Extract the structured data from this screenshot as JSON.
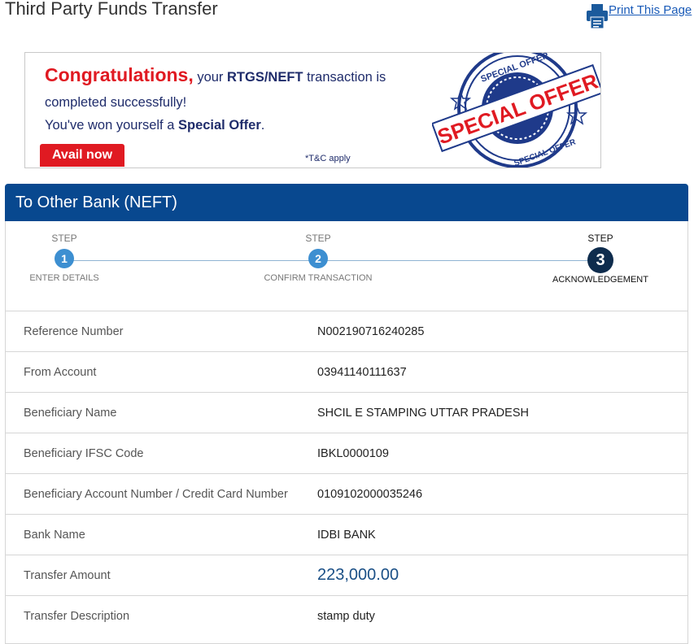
{
  "page": {
    "title": "Third Party Funds Transfer",
    "print_label": "Print This Page"
  },
  "banner": {
    "congrats": "Congratulations,",
    "line1_a": " your ",
    "line1_b": "RTGS/NEFT",
    "line1_c": " transaction is",
    "line2": "completed successfully!",
    "line3_a": "You've won yourself a ",
    "line3_b": "Special Offer",
    "line3_c": ".",
    "avail_label": "Avail now",
    "tc": "*T&C apply",
    "stamp_main": "SPECIAL OFFER",
    "stamp_ring": "SPECIAL OFFER"
  },
  "panel": {
    "title": "To Other Bank (NEFT)"
  },
  "steps": [
    {
      "caption": "STEP",
      "number": "1",
      "label": "ENTER DETAILS"
    },
    {
      "caption": "STEP",
      "number": "2",
      "label": "CONFIRM TRANSACTION"
    },
    {
      "caption": "STEP",
      "number": "3",
      "label": "ACKNOWLEDGEMENT"
    }
  ],
  "details": [
    {
      "label": "Reference Number",
      "value": "N002190716240285"
    },
    {
      "label": "From Account",
      "value": "03941140111637"
    },
    {
      "label": "Beneficiary Name",
      "value": "SHCIL E STAMPING UTTAR PRADESH"
    },
    {
      "label": "Beneficiary IFSC Code",
      "value": "IBKL0000109"
    },
    {
      "label": "Beneficiary Account Number / Credit Card Number",
      "value": "0109102000035246"
    },
    {
      "label": "Bank Name",
      "value": "IDBI BANK"
    },
    {
      "label": "Transfer Amount",
      "value": "223,000.00"
    },
    {
      "label": "Transfer Description",
      "value": "stamp duty"
    }
  ],
  "colors": {
    "header_blue": "#08488f",
    "step_blue": "#3d8fd1",
    "step_active": "#0e2c4d",
    "offer_red": "#e01a22",
    "link_blue": "#1a5bb8"
  }
}
